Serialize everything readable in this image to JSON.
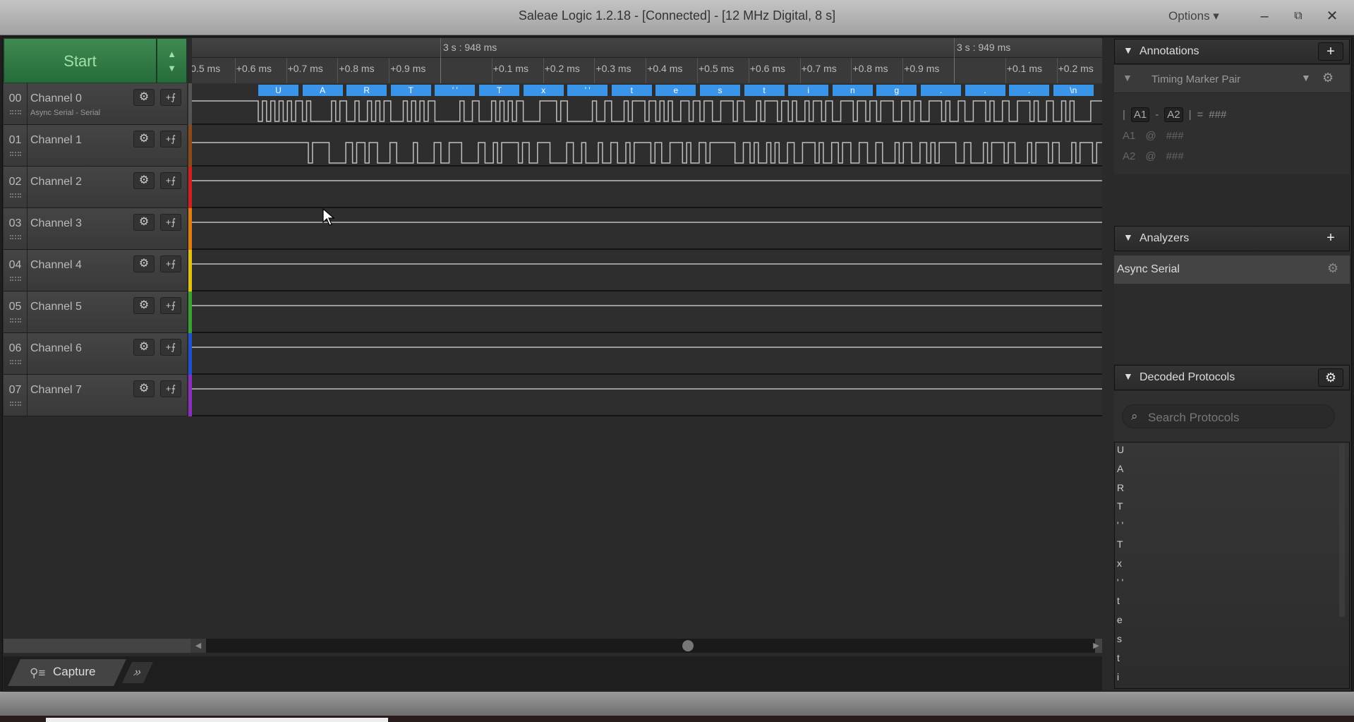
{
  "window": {
    "title": "Saleae Logic 1.2.18 - [Connected] - [12 MHz Digital, 8 s]",
    "options": "Options ▾",
    "minimize": "–",
    "restore": "⧉",
    "close": "✕"
  },
  "start": {
    "label": "Start",
    "arrows_up": "▲",
    "arrows_down": "▼"
  },
  "channels": [
    {
      "num": "00",
      "name": "Channel 0",
      "sub": "Async Serial - Serial",
      "color": "#555555"
    },
    {
      "num": "01",
      "name": "Channel 1",
      "sub": "",
      "color": "#8a4a1c"
    },
    {
      "num": "02",
      "name": "Channel 2",
      "sub": "",
      "color": "#d02020"
    },
    {
      "num": "03",
      "name": "Channel 3",
      "sub": "",
      "color": "#e07d10"
    },
    {
      "num": "04",
      "name": "Channel 4",
      "sub": "",
      "color": "#e0c010"
    },
    {
      "num": "05",
      "name": "Channel 5",
      "sub": "",
      "color": "#3aa030"
    },
    {
      "num": "06",
      "name": "Channel 6",
      "sub": "",
      "color": "#2050d0"
    },
    {
      "num": "07",
      "name": "Channel 7",
      "sub": "",
      "color": "#8a30c0"
    }
  ],
  "channel_buttons": {
    "settings": "⚙",
    "trigger": "+⨍"
  },
  "timeline": {
    "major": [
      "3 s : 948 ms",
      "3 s : 949 ms"
    ],
    "minor": [
      "+0.1 ms",
      "+0.2 ms",
      "+0.3 ms",
      "+0.4 ms",
      "+0.5 ms",
      "+0.6 ms",
      "+0.7 ms",
      "+0.8 ms",
      "+0.9 ms"
    ]
  },
  "decoded_bar": [
    "U",
    "A",
    "R",
    "T",
    "' '",
    "T",
    "x",
    "' '",
    "t",
    "e",
    "s",
    "t",
    "i",
    "n",
    "g",
    ".",
    ".",
    ".",
    "\\n"
  ],
  "waveform_color": "#bfbfbf",
  "decoded_color": "#3a95e8",
  "capture": {
    "tab": "Capture",
    "expand": "»"
  },
  "annotations": {
    "title": "Annotations",
    "add": "+",
    "marker_type": "Timing Marker Pair",
    "formula": {
      "bar1": "|",
      "a1": "A1",
      "minus": "-",
      "a2": "A2",
      "bar2": "|",
      "eq": "=",
      "val": "###"
    },
    "rows": [
      {
        "name": "A1",
        "at": "@",
        "val": "###"
      },
      {
        "name": "A2",
        "at": "@",
        "val": "###"
      }
    ]
  },
  "analyzers": {
    "title": "Analyzers",
    "add": "+",
    "items": [
      "Async Serial"
    ]
  },
  "decoded_protocols": {
    "title": "Decoded Protocols",
    "search_placeholder": "Search Protocols",
    "items": [
      "U",
      "A",
      "R",
      "T",
      "' '",
      "T",
      "x",
      "' '",
      "t",
      "e",
      "s",
      "t",
      "i"
    ]
  }
}
